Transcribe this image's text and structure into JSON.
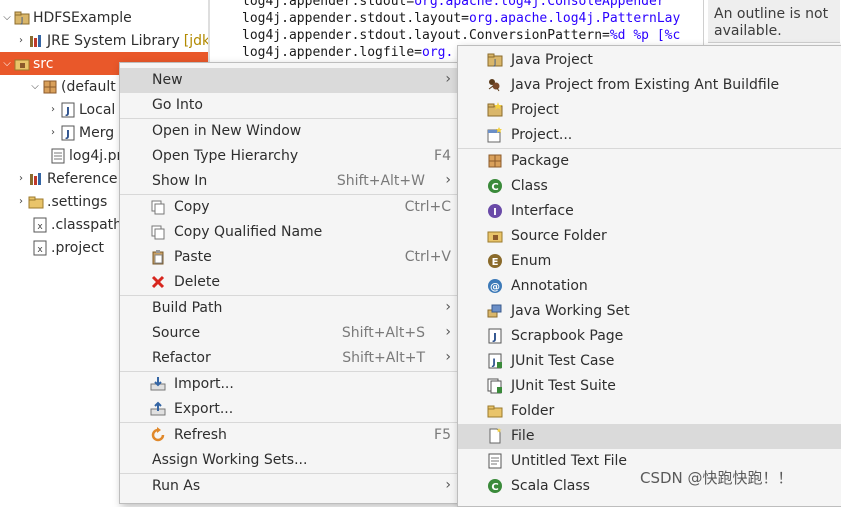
{
  "explorer": {
    "items": [
      {
        "twisty": "⌵",
        "label": "HDFSExample",
        "icon": "java-project-icon"
      },
      {
        "twisty": "›",
        "label": "JRE System Library",
        "suffix": "[jdk",
        "icon": "library-icon"
      },
      {
        "twisty": "⌵",
        "label": "src",
        "icon": "source-folder-icon"
      },
      {
        "twisty": "⌵",
        "label": "(default",
        "icon": "package-icon"
      },
      {
        "twisty": "›",
        "label": "Local",
        "icon": "java-file-icon"
      },
      {
        "twisty": "›",
        "label": "Merg",
        "icon": "java-file-icon"
      },
      {
        "twisty": "",
        "label": "log4j.pr",
        "icon": "properties-file-icon"
      },
      {
        "twisty": "›",
        "label": "Reference",
        "icon": "library-icon"
      },
      {
        "twisty": "›",
        "label": ".settings",
        "icon": "folder-icon"
      },
      {
        "twisty": "",
        "label": ".classpath",
        "icon": "xml-file-icon"
      },
      {
        "twisty": "",
        "label": ".project",
        "icon": "xml-file-icon"
      }
    ]
  },
  "editor": {
    "lines": [
      {
        "key": "log4j.appender.stdout=",
        "value": "org.apache.log4j.ConsoleAppender"
      },
      {
        "key": "log4j.appender.stdout.layout=",
        "value": "org.apache.log4j.PatternLay"
      },
      {
        "key": "log4j.appender.stdout.layout.ConversionPattern=",
        "value": "%d %p [%c"
      },
      {
        "key": "log4j.appender.logfile=",
        "value": "org."
      }
    ]
  },
  "outline": {
    "message": "An outline is not available."
  },
  "context_menu": {
    "items": [
      {
        "label": "New",
        "shortcut": "",
        "submenu": true
      },
      {
        "label": "Go Into",
        "shortcut": "",
        "submenu": false
      },
      {
        "label": "Open in New Window",
        "shortcut": "",
        "submenu": false
      },
      {
        "label": "Open Type Hierarchy",
        "shortcut": "F4",
        "submenu": false
      },
      {
        "label": "Show In",
        "shortcut": "Shift+Alt+W",
        "submenu": true
      },
      {
        "label": "Copy",
        "shortcut": "Ctrl+C",
        "icon": "copy-icon"
      },
      {
        "label": "Copy Qualified Name",
        "shortcut": "",
        "icon": "copy-qualified-icon"
      },
      {
        "label": "Paste",
        "shortcut": "Ctrl+V",
        "icon": "paste-icon"
      },
      {
        "label": "Delete",
        "shortcut": "",
        "icon": "delete-icon"
      },
      {
        "label": "Build Path",
        "shortcut": "",
        "submenu": true
      },
      {
        "label": "Source",
        "shortcut": "Shift+Alt+S",
        "submenu": true
      },
      {
        "label": "Refactor",
        "shortcut": "Shift+Alt+T",
        "submenu": true
      },
      {
        "label": "Import...",
        "shortcut": "",
        "icon": "import-icon"
      },
      {
        "label": "Export...",
        "shortcut": "",
        "icon": "export-icon"
      },
      {
        "label": "Refresh",
        "shortcut": "F5",
        "icon": "refresh-icon"
      },
      {
        "label": "Assign Working Sets...",
        "shortcut": ""
      },
      {
        "label": "Run As",
        "shortcut": "",
        "submenu": true
      }
    ],
    "arrow": "›"
  },
  "new_submenu": {
    "items": [
      {
        "label": "Java Project",
        "icon": "java-project-icon"
      },
      {
        "label": "Java Project from Existing Ant Buildfile",
        "icon": "ant-project-icon"
      },
      {
        "label": "Project",
        "icon": "project-icon"
      },
      {
        "label": "Project...",
        "icon": "new-project-wizard-icon"
      },
      {
        "label": "Package",
        "icon": "package-icon"
      },
      {
        "label": "Class",
        "icon": "class-icon"
      },
      {
        "label": "Interface",
        "icon": "interface-icon"
      },
      {
        "label": "Source Folder",
        "icon": "source-folder-icon"
      },
      {
        "label": "Enum",
        "icon": "enum-icon"
      },
      {
        "label": "Annotation",
        "icon": "annotation-icon"
      },
      {
        "label": "Java Working Set",
        "icon": "working-set-icon"
      },
      {
        "label": "Scrapbook Page",
        "icon": "scrapbook-icon"
      },
      {
        "label": "JUnit Test Case",
        "icon": "junit-test-case-icon"
      },
      {
        "label": "JUnit Test Suite",
        "icon": "junit-test-suite-icon"
      },
      {
        "label": "Folder",
        "icon": "folder-icon"
      },
      {
        "label": "File",
        "icon": "file-icon"
      },
      {
        "label": "Untitled Text File",
        "icon": "text-file-icon"
      },
      {
        "label": "Scala Class",
        "icon": "scala-class-icon"
      }
    ]
  },
  "watermark": "CSDN @快跑快跑！！",
  "colors": {
    "selection": "#e9582a",
    "menu_bg": "#f5f5f5",
    "menu_hover": "#dadada",
    "string_blue": "#2a00ff"
  }
}
